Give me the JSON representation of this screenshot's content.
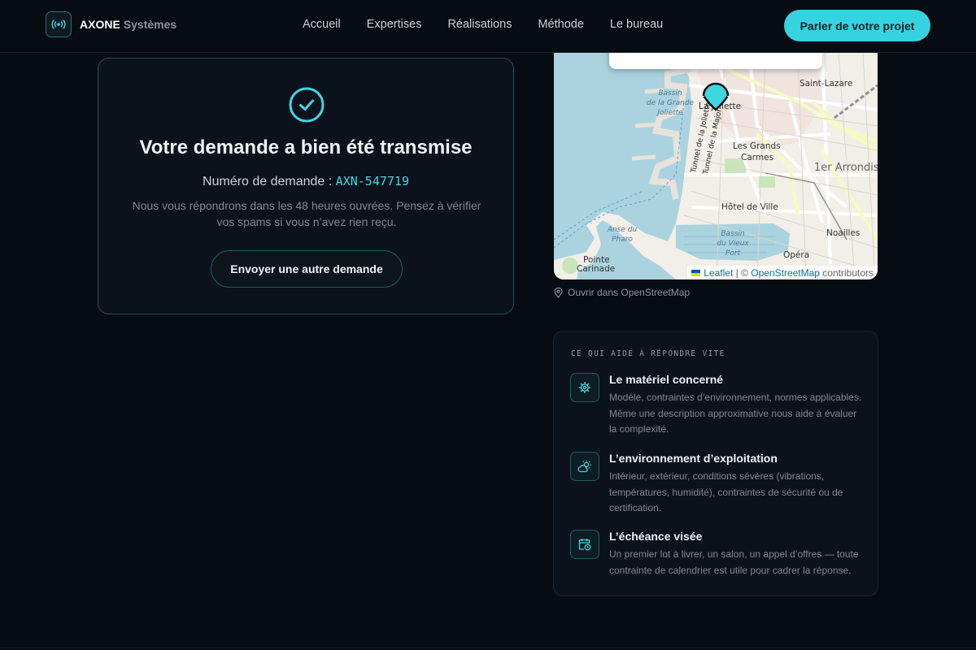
{
  "brand": {
    "name": "AXONE",
    "suffix": "Systèmes",
    "logo_icon": "broadcast-icon"
  },
  "nav": {
    "items": [
      "Accueil",
      "Expertises",
      "Réalisations",
      "Méthode",
      "Le bureau"
    ],
    "cta": "Parler de votre projet"
  },
  "confirmation": {
    "icon": "check-circle-icon",
    "title": "Votre demande a bien été transmise",
    "request_label": "Numéro de demande :",
    "request_id": "AXN-547719",
    "note": "Nous vous répondrons dans les 48 heures ouvrées. Pensez à vérifier vos spams si vous n’avez rien reçu.",
    "button": "Envoyer une autre demande"
  },
  "map": {
    "labels": {
      "saint_lazare": "Saint-Lazare",
      "la_joliette": "La Joliette",
      "bassin_grande_joliette_1": "Bassin",
      "bassin_grande_joliette_2": "de la Grande",
      "bassin_grande_joliette_3": "Joliette",
      "tunnel_joliette": "Tunnel de la Joliette",
      "tunnel_major": "Tunnel de la Major",
      "grands_carmes_1": "Les Grands",
      "grands_carmes_2": "Carmes",
      "arrondissement": "1er Arrondis",
      "hotel_de_ville": "Hôtel de Ville",
      "anse_pharo_1": "Anse du",
      "anse_pharo_2": "Pharo",
      "bassin_vieux_port_1": "Bassin",
      "bassin_vieux_port_2": "du Vieux",
      "bassin_vieux_port_3": "Port",
      "noailles": "Noailles",
      "opera": "Opéra",
      "pointe_carinade_1": "Pointe",
      "pointe_carinade_2": "Carinade"
    },
    "attribution": {
      "leaflet": "Leaflet",
      "separator": " | © ",
      "osm": "OpenStreetMap",
      "suffix": " contributors"
    },
    "open_link": "Ouvrir dans OpenStreetMap",
    "colors": {
      "water": "#aad3df",
      "land": "#f2efe9",
      "marker": "#3fd6e2"
    }
  },
  "tips": {
    "heading": "CE QUI AIDE À RÉPONDRE VITE",
    "items": [
      {
        "icon": "cpu-gear-icon",
        "title": "Le matériel concerné",
        "desc": "Modèle, contraintes d’environnement, normes applicables. Même une description approximative nous aide à évaluer la complexité."
      },
      {
        "icon": "sun-cloud-icon",
        "title": "L’environnement d’exploitation",
        "desc": "Intérieur, extérieur, conditions sévères (vibrations, températures, humidité), contraintes de sécurité ou de certification."
      },
      {
        "icon": "calendar-clock-icon",
        "title": "L’échéance visée",
        "desc": "Un premier lot à livrer, un salon, un appel d’offres — toute contrainte de calendrier est utile pour cadrer la réponse."
      }
    ]
  },
  "theme": {
    "accent": "#35d3df",
    "background": "#070b12",
    "card": "#0c121b"
  }
}
